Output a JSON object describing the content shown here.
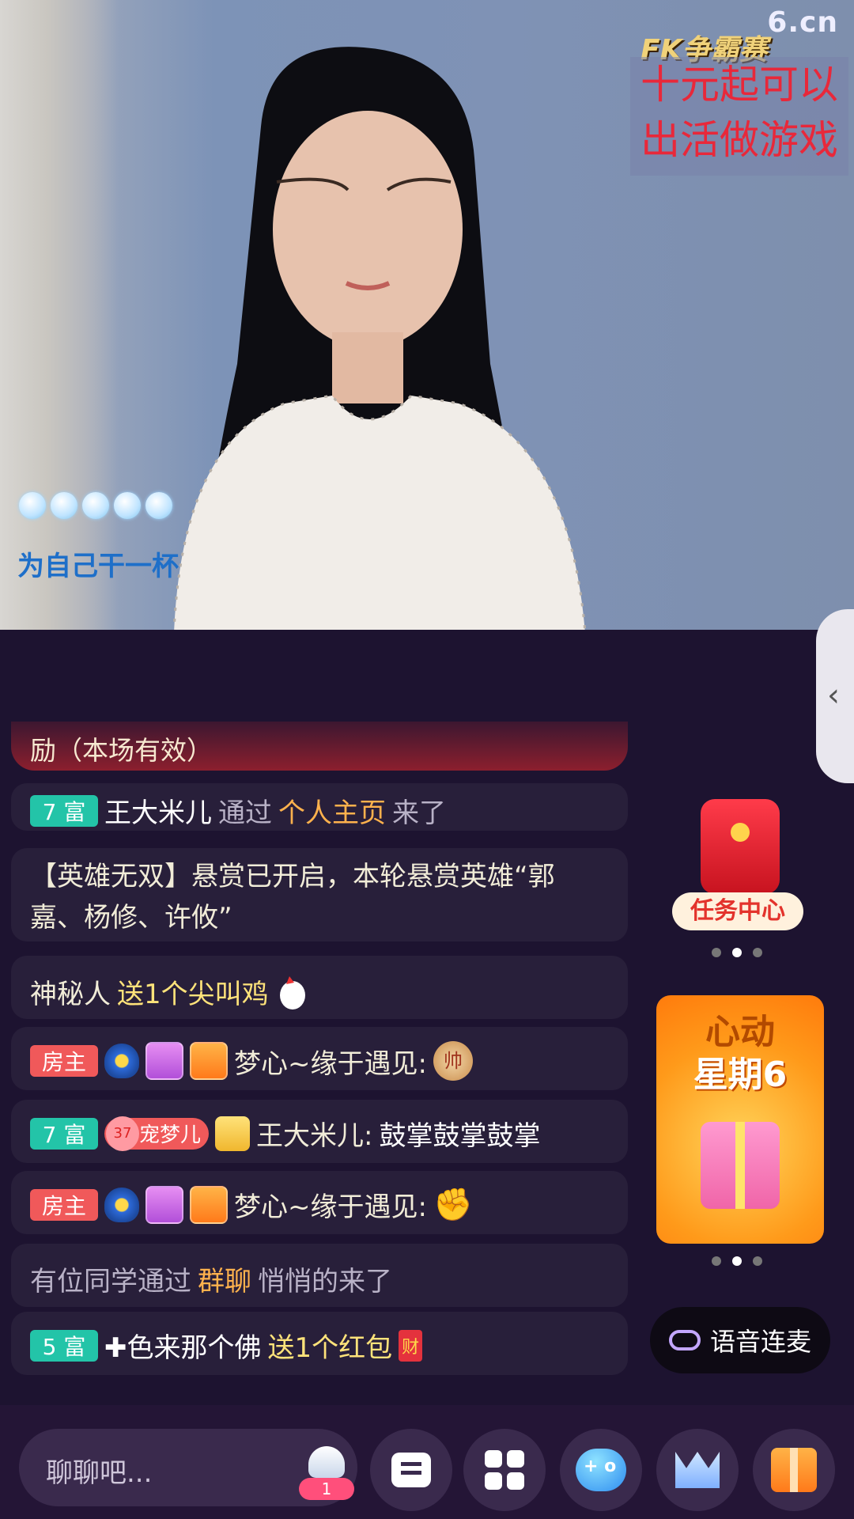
{
  "video": {
    "watermark": "6.cn",
    "pk_title": "FK争霸赛",
    "promo_lines": [
      "十元起可以",
      "出活做游戏"
    ],
    "cheer_text": "为自己干一杯"
  },
  "chat": {
    "banner_text": "励（本场有效）",
    "messages": [
      {
        "badge": "7 富",
        "user": "王大米儿",
        "text1": "通过",
        "highlight": "个人主页",
        "text2": "来了"
      },
      {
        "line1": "【英雄无双】悬赏已开启，本轮悬赏英雄“郭",
        "line2": "嘉、杨修、许攸”"
      },
      {
        "user": "神秘人",
        "action": "送1个尖叫鸡"
      },
      {
        "badge": "房主",
        "user": "梦心~缘于遇见:",
        "emoji": "帅"
      },
      {
        "badge": "7 富",
        "pet": "宠梦儿",
        "pet_level": "37",
        "user": "王大米儿:",
        "text": "鼓掌鼓掌鼓掌"
      },
      {
        "badge": "房主",
        "user": "梦心~缘于遇见:",
        "emoji": "✊"
      },
      {
        "text1": "有位同学通过",
        "highlight": "群聊",
        "text2": "悄悄的来了"
      },
      {
        "badge": "5 富",
        "user": "✚色来那个佛",
        "action": "送1个红包",
        "tag": "财"
      }
    ]
  },
  "side": {
    "task_label": "任务中心",
    "week_line1": "心动",
    "week_line2": "星期6",
    "voice_label": "语音连麦"
  },
  "bottom": {
    "input_placeholder": "聊聊吧...",
    "online_count": "1"
  }
}
